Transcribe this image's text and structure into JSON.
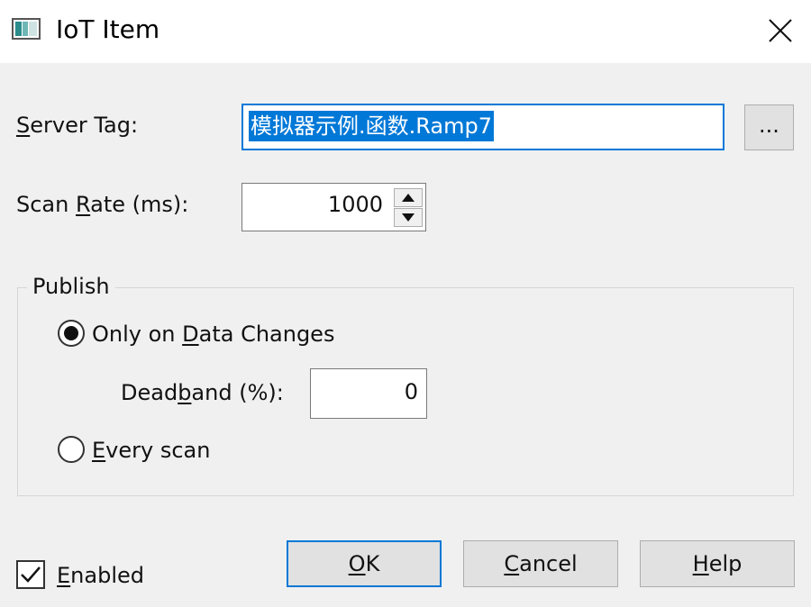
{
  "window": {
    "title": "IoT Item"
  },
  "server_tag": {
    "label_mnemonic": "S",
    "label_rest": "erver Tag:",
    "value": "模拟器示例.函数.Ramp7",
    "browse_label": "..."
  },
  "scan_rate": {
    "label_pre": "Scan ",
    "label_mnemonic": "R",
    "label_post": "ate (ms):",
    "value": "1000"
  },
  "publish": {
    "group_title": "Publish",
    "only_on_changes": {
      "label_pre": "Only on ",
      "label_mnemonic": "D",
      "label_post": "ata Changes",
      "selected": true
    },
    "deadband": {
      "label_pre": "Dead",
      "label_mnemonic": "b",
      "label_post": "and (%):",
      "value": "0"
    },
    "every_scan": {
      "label_mnemonic": "E",
      "label_post": "very scan",
      "selected": false
    }
  },
  "enabled": {
    "label_mnemonic": "E",
    "label_post": "nabled",
    "checked": true
  },
  "buttons": {
    "ok_mnemonic": "O",
    "ok_rest": "K",
    "cancel_mnemonic": "C",
    "cancel_rest": "ancel",
    "help_mnemonic": "H",
    "help_rest": "elp"
  },
  "colors": {
    "accent": "#0078d7",
    "dialog_bg": "#f0f0f0",
    "button_bg": "#e1e1e1"
  }
}
